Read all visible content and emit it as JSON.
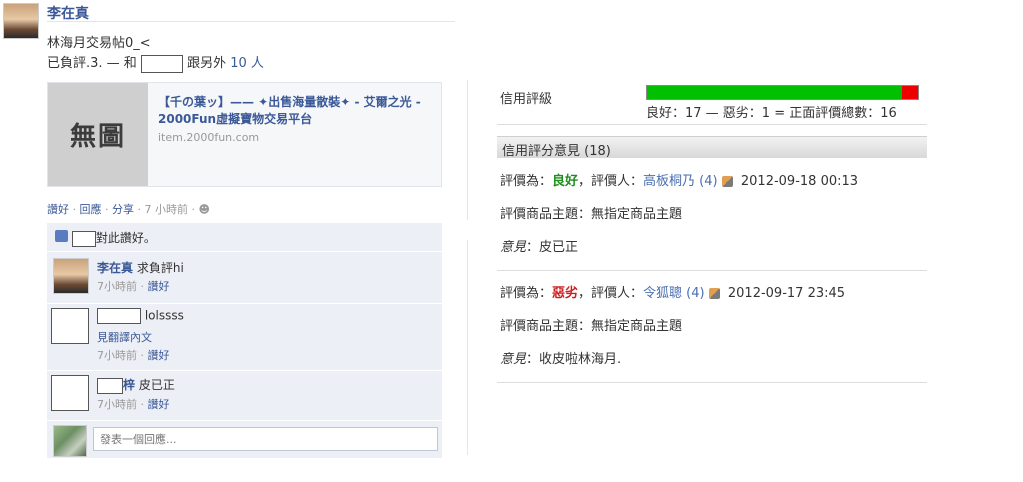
{
  "post": {
    "author": "李在真",
    "text": "林海月交易帖0_<",
    "tag_prefix": "已負評.3. — 和",
    "tag_suffix": "跟另外",
    "tag_count": "10 人",
    "preview": {
      "image_text": "無圖",
      "title": "【千の葉ッ】—— ✦出售海量散裝✦ - 艾爾之光 - 2000Fun虛擬寶物交易平台",
      "url": "item.2000fun.com"
    },
    "actions": {
      "like": "讚好",
      "dot1": "·",
      "reply": "回應",
      "dot2": "·",
      "share": "分享",
      "dot3": "·",
      "time": "7 小時前",
      "dot4": "·"
    },
    "likes_text": "對此讚好。",
    "comments": [
      {
        "author": "李在真",
        "text": "求負評hi",
        "time": "7小時前",
        "dot": "·",
        "like": "讚好"
      },
      {
        "author_suffix": "",
        "text": "lolssss",
        "translate": "見翻譯內文",
        "time": "7小時前",
        "dot": "·",
        "like": "讚好"
      },
      {
        "author_suffix": "梓",
        "text": "皮已正",
        "time": "7小時前",
        "dot": "·",
        "like": "讚好"
      }
    ],
    "comment_input_placeholder": "發表一個回應..."
  },
  "rating": {
    "label": "信用評級",
    "good_fraction": 0.94,
    "colors": {
      "good": "#00c000",
      "bad": "#ee0000"
    },
    "summary": "良好：17 — 惡劣：1 = 正面評價總數：16",
    "section_title": "信用評分意見 (18)",
    "entries": [
      {
        "rating_prefix": "評價為：",
        "rating": "良好",
        "rater_prefix": "，評價人：",
        "rater": "高板桐乃 (4)",
        "datetime": "2012-09-18 00:13",
        "product": "評價商品主題：無指定商品主題",
        "opinion_label": "意見",
        "opinion": "：皮已正"
      },
      {
        "rating_prefix": "評價為：",
        "rating": "惡劣",
        "rater_prefix": "，評價人：",
        "rater": "令狐聰 (4)",
        "datetime": "2012-09-17 23:45",
        "product": "評價商品主題：無指定商品主題",
        "opinion_label": "意見",
        "opinion": "：收皮啦林海月."
      }
    ]
  }
}
